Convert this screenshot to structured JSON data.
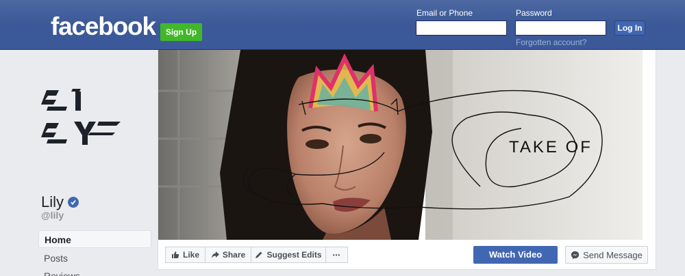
{
  "header": {
    "logo_text": "facebook",
    "signup_label": "Sign Up",
    "email_label": "Email or Phone",
    "email_value": "",
    "password_label": "Password",
    "password_value": "",
    "login_label": "Log In",
    "forgot_label": "Forgotten account?"
  },
  "profile": {
    "logo_text": "LILY",
    "name": "Lily",
    "handle": "@lily",
    "verified": true,
    "nav": [
      {
        "label": "Home",
        "active": true
      },
      {
        "label": "Posts",
        "active": false
      },
      {
        "label": "Reviews",
        "active": false
      }
    ]
  },
  "cover": {
    "overlay_text": "TAKE OF"
  },
  "actions": {
    "like_label": "Like",
    "share_label": "Share",
    "suggest_label": "Suggest Edits",
    "more_label": "•••",
    "watch_label": "Watch Video",
    "message_label": "Send Message"
  },
  "colors": {
    "brand_blue": "#3b5998",
    "button_blue": "#4267b2",
    "signup_green": "#42b72a",
    "page_bg": "#e9ebee"
  }
}
